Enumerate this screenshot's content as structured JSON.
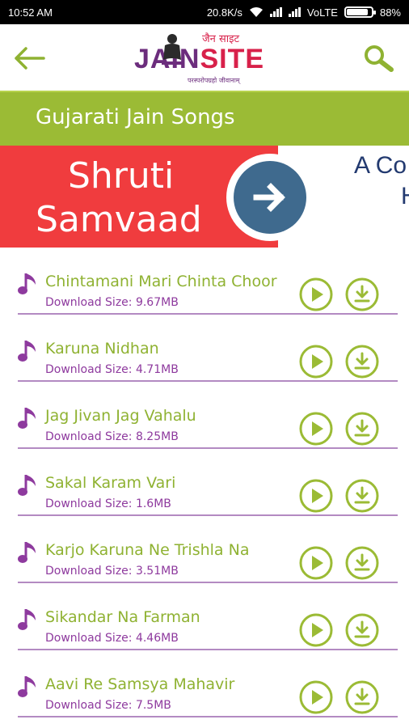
{
  "status_bar": {
    "time": "10:52 AM",
    "speed": "20.8K/s",
    "network": "VoLTE",
    "battery": "88%",
    "battery_level": 0.88
  },
  "header": {
    "logo_text_main": "JAIN",
    "logo_text_accent": "SITE",
    "logo_top_script": "जैन साइट",
    "logo_tagline": "परस्परोपग्रहो जीवानाम्",
    "back_icon": "arrow-left-icon",
    "search_icon": "search-icon"
  },
  "page": {
    "title": "Gujarati Jain Songs"
  },
  "banner": {
    "line1": "Shruti",
    "line2": "Samvaad",
    "right_line1": "A Co",
    "right_line2": "H",
    "arrow_icon": "arrow-right-icon"
  },
  "colors": {
    "accent_green": "#9bbb35",
    "title_green": "#8fb232",
    "purple": "#8e3a9e",
    "banner_red": "#f03c3e",
    "banner_blue": "#3f6a8e"
  },
  "size_prefix": "Download Size: ",
  "songs": [
    {
      "title": "Chintamani Mari Chinta Choor",
      "size": "Download Size: 9.67MB"
    },
    {
      "title": "Karuna Nidhan",
      "size": "Download Size: 4.71MB"
    },
    {
      "title": "Jag Jivan Jag Vahalu",
      "size": "Download Size: 8.25MB"
    },
    {
      "title": "Sakal Karam Vari",
      "size": "Download Size: 1.6MB"
    },
    {
      "title": "Karjo Karuna Ne Trishla Na",
      "size": "Download Size: 3.51MB"
    },
    {
      "title": "Sikandar Na Farman",
      "size": "Download Size: 4.46MB"
    },
    {
      "title": "Aavi Re Samsya Mahavir",
      "size": "Download Size: 7.5MB"
    }
  ]
}
